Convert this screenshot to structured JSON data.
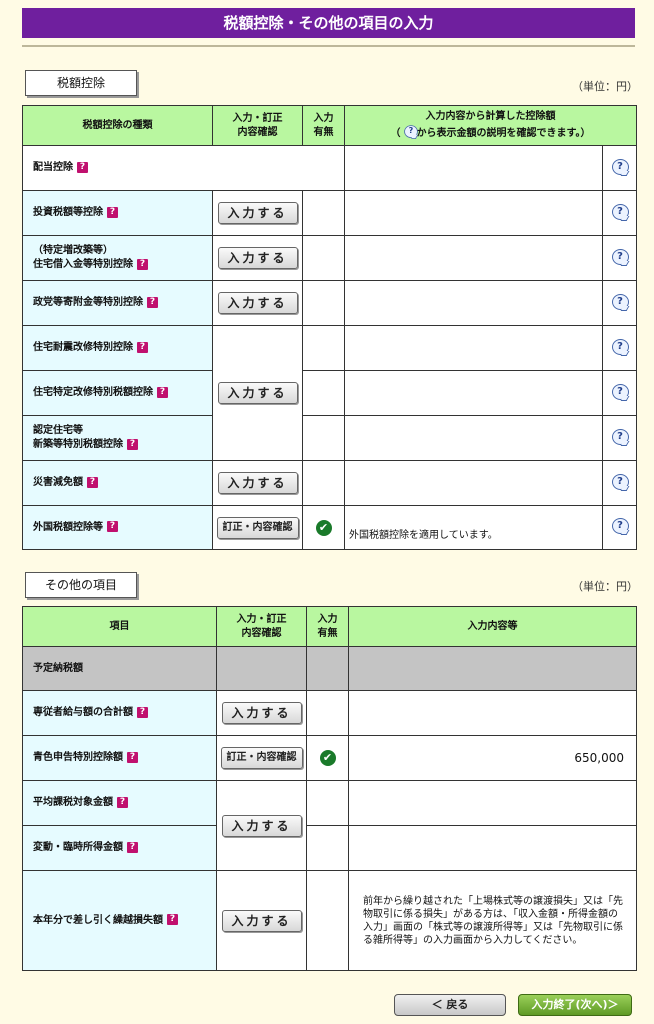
{
  "page": {
    "title": "税額控除・その他の項目の入力"
  },
  "section1": {
    "tab": "税額控除",
    "unit": "（単位：円）",
    "headers": {
      "kind": "税額控除の種類",
      "input": "入力・訂正\n内容確認",
      "status": "入力\n有無",
      "amount_line1": "入力内容から計算した控除額",
      "amount_line2_pre": "（",
      "amount_line2_post": "から表示金額の説明を確認できます。）"
    },
    "rows": [
      {
        "label": "配当控除"
      },
      {
        "label": "投資税額等控除",
        "button": "入力する"
      },
      {
        "label": "（特定増改築等）\n住宅借入金等特別控除",
        "button": "入力する"
      },
      {
        "label": "政党等寄附金等特別控除",
        "button": "入力する"
      },
      {
        "label": "住宅耐震改修特別控除"
      },
      {
        "label": "住宅特定改修特別税額控除",
        "button": "入力する"
      },
      {
        "label": "認定住宅等\n新築等特別税額控除"
      },
      {
        "label": "災害減免額",
        "button": "入力する"
      },
      {
        "label": "外国税額控除等",
        "button": "訂正・内容確認",
        "note": "外国税額控除を適用しています。"
      }
    ]
  },
  "section2": {
    "tab": "その他の項目",
    "unit": "（単位：円）",
    "headers": {
      "item": "項目",
      "input": "入力・訂正\n内容確認",
      "status": "入力\n有無",
      "content": "入力内容等"
    },
    "rows": [
      {
        "label": "予定納税額"
      },
      {
        "label": "専従者給与額の合計額",
        "button": "入力する"
      },
      {
        "label": "青色申告特別控除額",
        "button": "訂正・内容確認",
        "value": "650,000"
      },
      {
        "label": "平均課税対象金額",
        "button": "入力する"
      },
      {
        "label": "変動・臨時所得金額"
      },
      {
        "label": "本年分で差し引く繰越損失額",
        "button": "入力する",
        "note": "前年から繰り越された「上場株式等の譲渡損失」又は「先物取引に係る損失」がある方は、「収入金額・所得金額の入力」画面の「株式等の譲渡所得等」又は「先物取引に係る雑所得等」の入力画面から入力してください。"
      }
    ]
  },
  "nav": {
    "back": "＜ 戻る",
    "next": "入力終了(次へ)＞"
  },
  "icons": {
    "help": "help-balloon-icon",
    "qmark": "question-mark-icon",
    "check": "check-circle-icon"
  },
  "glyphs": {
    "q": "?",
    "check": "✔"
  },
  "colors": {
    "title": "#6f1f9e",
    "header": "#b9f7a0",
    "label_bg": "#e6fbff",
    "bg": "#fffbe5"
  }
}
